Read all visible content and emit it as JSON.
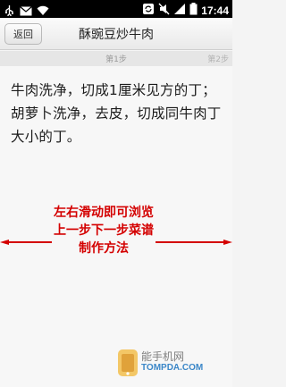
{
  "status_bar": {
    "time": "17:44",
    "left_icons": [
      "usb-icon",
      "email-icon",
      "wifi-icon"
    ],
    "right_icons": [
      "sync-icon",
      "mute-icon",
      "signal-icon",
      "battery-icon"
    ]
  },
  "header": {
    "back_label": "返回",
    "title": "酥豌豆炒牛肉"
  },
  "steps": {
    "current_label": "第1步",
    "next_label": "第2步"
  },
  "content": {
    "text": "牛肉洗净，切成1厘米见方的丁；胡萝卜洗净，去皮，切成同牛肉丁大小的丁。"
  },
  "hint": {
    "text": "左右滑动即可浏览上一步下一步菜谱制作方法",
    "color": "#d40000"
  },
  "watermark": {
    "name": "能手机网",
    "domain": "TOMPDA.COM"
  }
}
